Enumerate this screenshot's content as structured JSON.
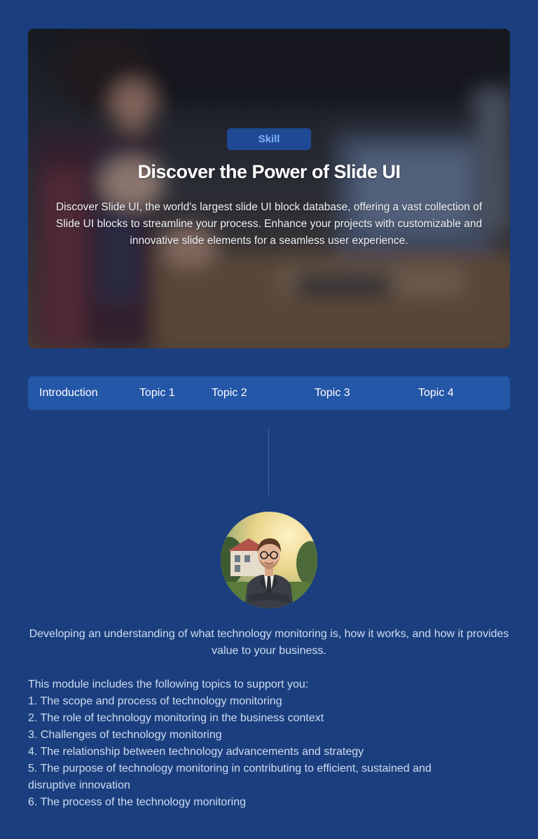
{
  "hero": {
    "badge": "Skill",
    "title": "Discover the Power of Slide UI",
    "description": "Discover Slide UI, the world's largest slide UI block database, offering a vast collection of Slide UI blocks to streamline your process. Enhance your projects with customizable and innovative slide elements for a seamless user experience."
  },
  "tabs": [
    {
      "label": "Introduction"
    },
    {
      "label": "Topic 1"
    },
    {
      "label": "Topic 2"
    },
    {
      "label": "Topic 3"
    },
    {
      "label": "Topic 4"
    }
  ],
  "content": {
    "lead": "Developing an understanding of what technology monitoring is, how it works, and how it provides value to your business.",
    "module_intro": "This module includes the following topics to support you:",
    "topics": [
      "1. The scope and process of technology monitoring",
      "2. The role of technology monitoring in the business context",
      "3. Challenges of technology monitoring",
      "4. The relationship between technology advancements and strategy",
      "5. The purpose of technology monitoring in contributing to efficient, sustained and disruptive innovation",
      "6. The process of the technology monitoring"
    ]
  },
  "colors": {
    "background": "#1b3f7e",
    "tab_bar": "#2457a8",
    "badge_bg": "#1f4a93",
    "badge_text": "#7fb0ff",
    "body_text": "#cfdcf2"
  }
}
